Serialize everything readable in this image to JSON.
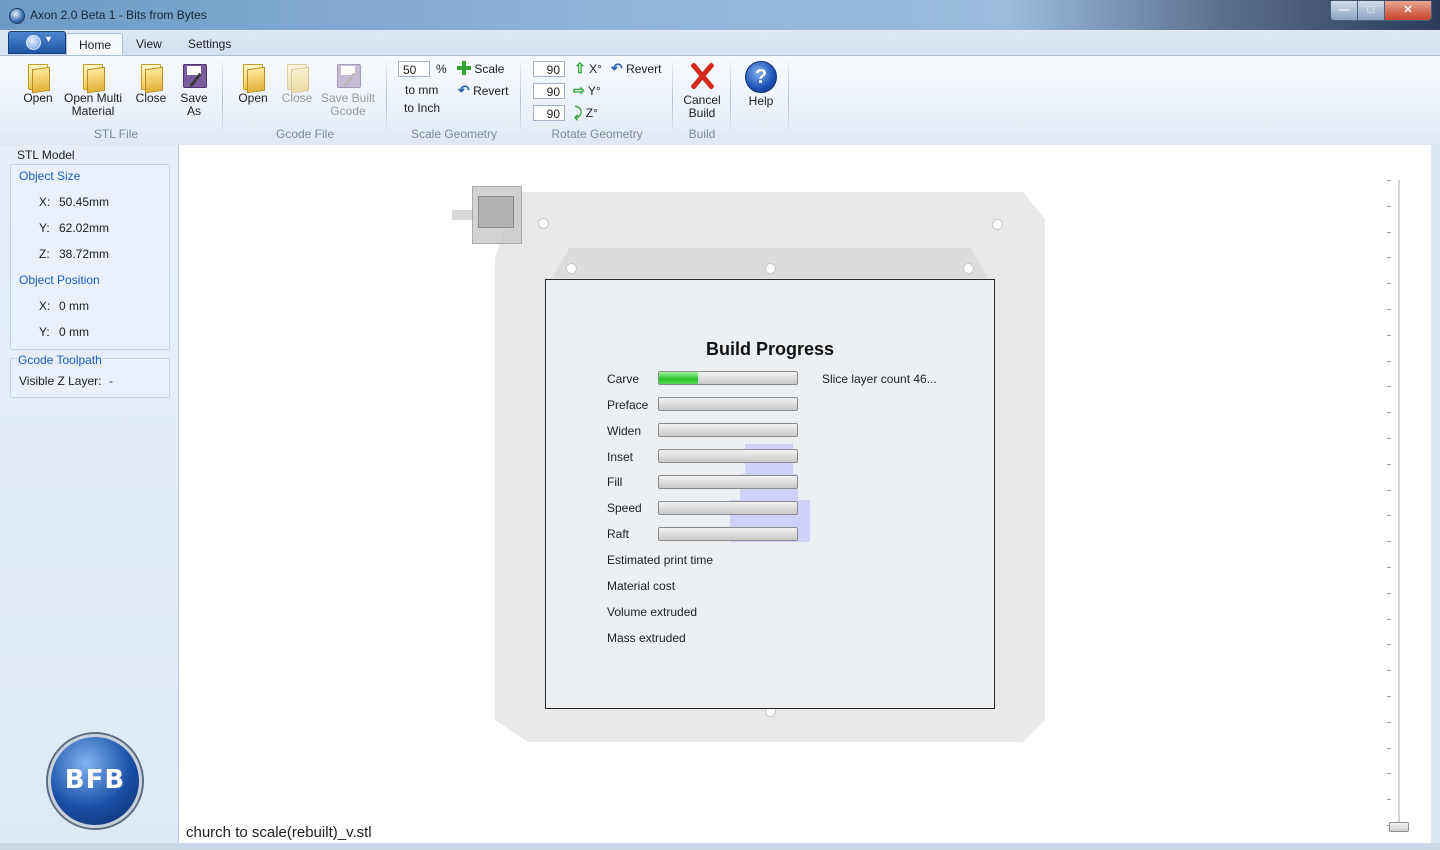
{
  "window": {
    "title": "Axon 2.0 Beta 1 - Bits from Bytes"
  },
  "ribbon": {
    "tabs": [
      "Home",
      "View",
      "Settings"
    ],
    "stl_file": {
      "group_label": "STL File",
      "open": "Open",
      "open_multi": "Open Multi\nMaterial",
      "close": "Close",
      "save_as": "Save\nAs"
    },
    "gcode_file": {
      "group_label": "Gcode File",
      "open": "Open",
      "close": "Close",
      "save_built": "Save Built\nGcode"
    },
    "scale_geometry": {
      "group_label": "Scale Geometry",
      "percent_value": "50",
      "percent_sign": "%",
      "to_mm": "to mm",
      "to_inch": "to Inch",
      "scale": "Scale",
      "revert": "Revert"
    },
    "rotate_geometry": {
      "group_label": "Rotate Geometry",
      "x_value": "90",
      "y_value": "90",
      "z_value": "90",
      "x_label": "X°",
      "y_label": "Y°",
      "z_label": "Z°",
      "revert": "Revert"
    },
    "build": {
      "group_label": "Build",
      "cancel": "Cancel\nBuild"
    },
    "help": {
      "label": "Help"
    }
  },
  "left_panel": {
    "stl_model_title": "STL Model",
    "object_size_title": "Object Size",
    "size_x_label": "X:",
    "size_x": "50.45mm",
    "size_y_label": "Y:",
    "size_y": "62.02mm",
    "size_z_label": "Z:",
    "size_z": "38.72mm",
    "object_position_title": "Object Position",
    "pos_x_label": "X:",
    "pos_x": "0 mm",
    "pos_y_label": "Y:",
    "pos_y": "0 mm",
    "gcode_toolpath_title": "Gcode Toolpath",
    "visible_z_label": "Visible Z Layer:",
    "visible_z_value": "-",
    "logo_text": "BFB"
  },
  "build_progress": {
    "title": "Build Progress",
    "steps": [
      {
        "label": "Carve",
        "progress": 0.28
      },
      {
        "label": "Preface",
        "progress": 0
      },
      {
        "label": "Widen",
        "progress": 0
      },
      {
        "label": "Inset",
        "progress": 0
      },
      {
        "label": "Fill",
        "progress": 0
      },
      {
        "label": "Speed",
        "progress": 0
      },
      {
        "label": "Raft",
        "progress": 0
      }
    ],
    "status": "Slice layer count 46...",
    "estimated_print_time": "Estimated print time",
    "material_cost": "Material cost",
    "volume_extruded": "Volume extruded",
    "mass_extruded": "Mass extruded"
  },
  "status": {
    "filename": "church to scale(rebuilt)_v.stl"
  }
}
